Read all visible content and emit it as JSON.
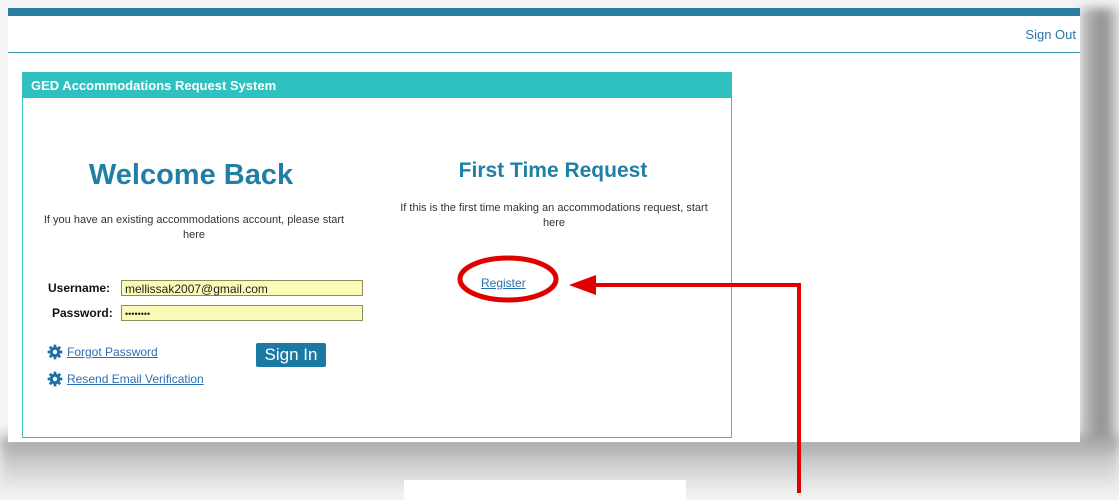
{
  "header": {
    "sign_out": "Sign Out"
  },
  "panel": {
    "title": "GED Accommodations Request System",
    "welcome": {
      "title": "Welcome Back",
      "description": "If you have an existing accommodations account, please start here",
      "username_label": "Username:",
      "username_value": "mellissak2007@gmail.com",
      "password_label": "Password:",
      "password_value": "••••••••",
      "sign_in": "Sign In",
      "forgot_password": "Forgot Password",
      "resend_verification": "Resend Email Verification"
    },
    "first_time": {
      "title": "First Time Request",
      "description": "If this is the first time making an accommodations request, start here",
      "register": "Register"
    }
  },
  "colors": {
    "accent": "#2fc0c0",
    "brand": "#1f7fa6",
    "annotation": "#e00000",
    "input_fill": "#fbfbb8"
  },
  "icons": [
    "gear-icon"
  ]
}
